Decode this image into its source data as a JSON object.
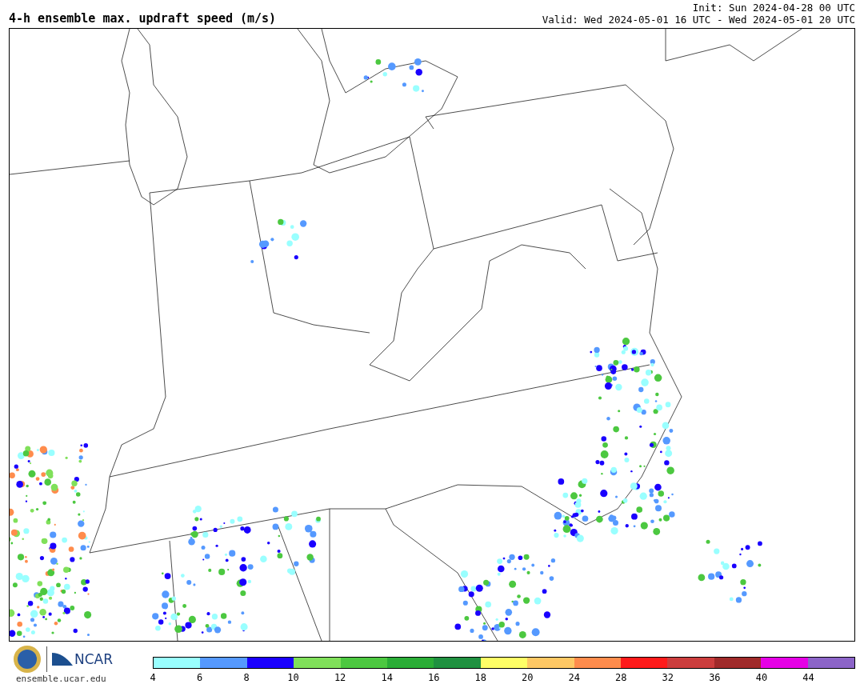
{
  "title": "4-h ensemble max. updraft speed (m/s)",
  "init": "Init: Sun 2024-04-28 00 UTC",
  "valid": "Valid: Wed 2024-05-01 16 UTC - Wed 2024-05-01 20 UTC",
  "logos": {
    "ncar": "NCAR",
    "site": "ensemble.ucar.edu"
  },
  "colorbar": [
    {
      "label": "4",
      "color": "#99ffff"
    },
    {
      "label": "6",
      "color": "#5599ff"
    },
    {
      "label": "8",
      "color": "#1a00ff"
    },
    {
      "label": "10",
      "color": "#80e05a"
    },
    {
      "label": "12",
      "color": "#4cc840"
    },
    {
      "label": "14",
      "color": "#2aad36"
    },
    {
      "label": "16",
      "color": "#1f9140"
    },
    {
      "label": "18",
      "color": "#ffff66"
    },
    {
      "label": "20",
      "color": "#ffc864"
    },
    {
      "label": "24",
      "color": "#ff8c4c"
    },
    {
      "label": "28",
      "color": "#ff1a1a"
    },
    {
      "label": "32",
      "color": "#cc3d3d"
    },
    {
      "label": "36",
      "color": "#a02a2a"
    },
    {
      "label": "40",
      "color": "#e600e6"
    },
    {
      "label": "44",
      "color": "#8c64c8"
    }
  ]
}
